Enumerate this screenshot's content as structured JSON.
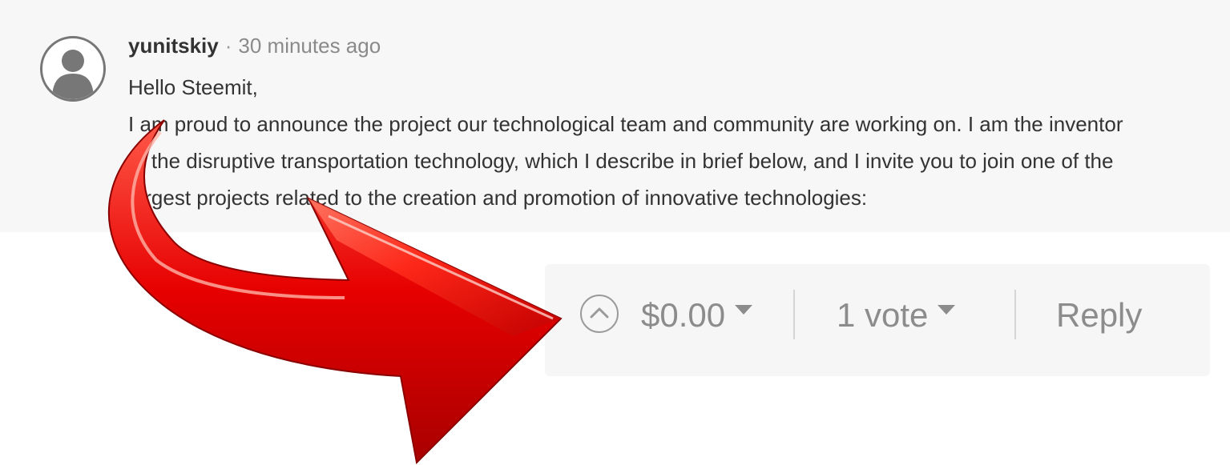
{
  "comment": {
    "author": "yunitskiy",
    "separator": "·",
    "timestamp": "30 minutes ago",
    "body_lines": [
      "Hello Steemit,",
      "I am proud to announce the project our technological team and community are working on. I am the inventor",
      "of the disruptive transportation technology, which I describe in brief below, and I invite you to join one of the",
      "largest projects related to the creation and promotion of innovative technologies:"
    ]
  },
  "footer": {
    "upvote_icon": "chevron-up-circle-icon",
    "payout": "$0.00",
    "payout_caret_icon": "caret-down-icon",
    "votes": "1 vote",
    "votes_caret_icon": "caret-down-icon",
    "reply_label": "Reply"
  },
  "overlay": {
    "arrow_icon": "curved-red-arrow-icon",
    "arrow_color": "#e00000"
  }
}
